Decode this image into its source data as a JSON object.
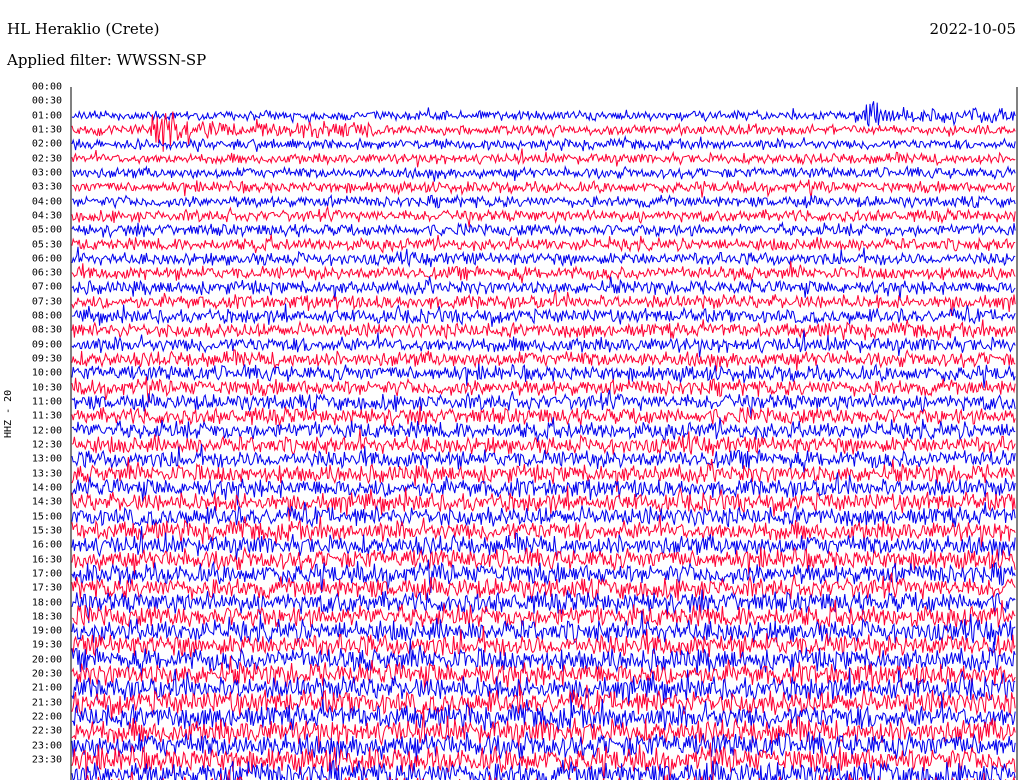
{
  "header": {
    "station": "HL Heraklio (Crete)",
    "date": "2022-10-05",
    "filter": "Applied filter: WWSSN-SP"
  },
  "y_axis_label": "HHZ - 20",
  "colors": {
    "a": "#0000ee",
    "b": "#ff0033"
  },
  "chart_data": {
    "type": "line",
    "ylabels": [
      "00:00",
      "00:30",
      "01:00",
      "01:30",
      "02:00",
      "02:30",
      "03:00",
      "03:30",
      "04:00",
      "04:30",
      "05:00",
      "05:30",
      "06:00",
      "06:30",
      "07:00",
      "07:30",
      "08:00",
      "08:30",
      "09:00",
      "09:30",
      "10:00",
      "10:30",
      "11:00",
      "11:30",
      "12:00",
      "12:30",
      "13:00",
      "13:30",
      "14:00",
      "14:30",
      "15:00",
      "15:30",
      "16:00",
      "16:30",
      "17:00",
      "17:30",
      "18:00",
      "18:30",
      "19:00",
      "19:30",
      "20:00",
      "20:30",
      "21:00",
      "21:30",
      "22:00",
      "22:30",
      "23:00",
      "23:30"
    ],
    "active_from": "01:00",
    "events": [
      {
        "row": "01:30",
        "offset_fraction": 0.1,
        "amplitude": "large"
      },
      {
        "row": "01:00",
        "offset_fraction": 0.83,
        "amplitude": "medium"
      }
    ]
  }
}
